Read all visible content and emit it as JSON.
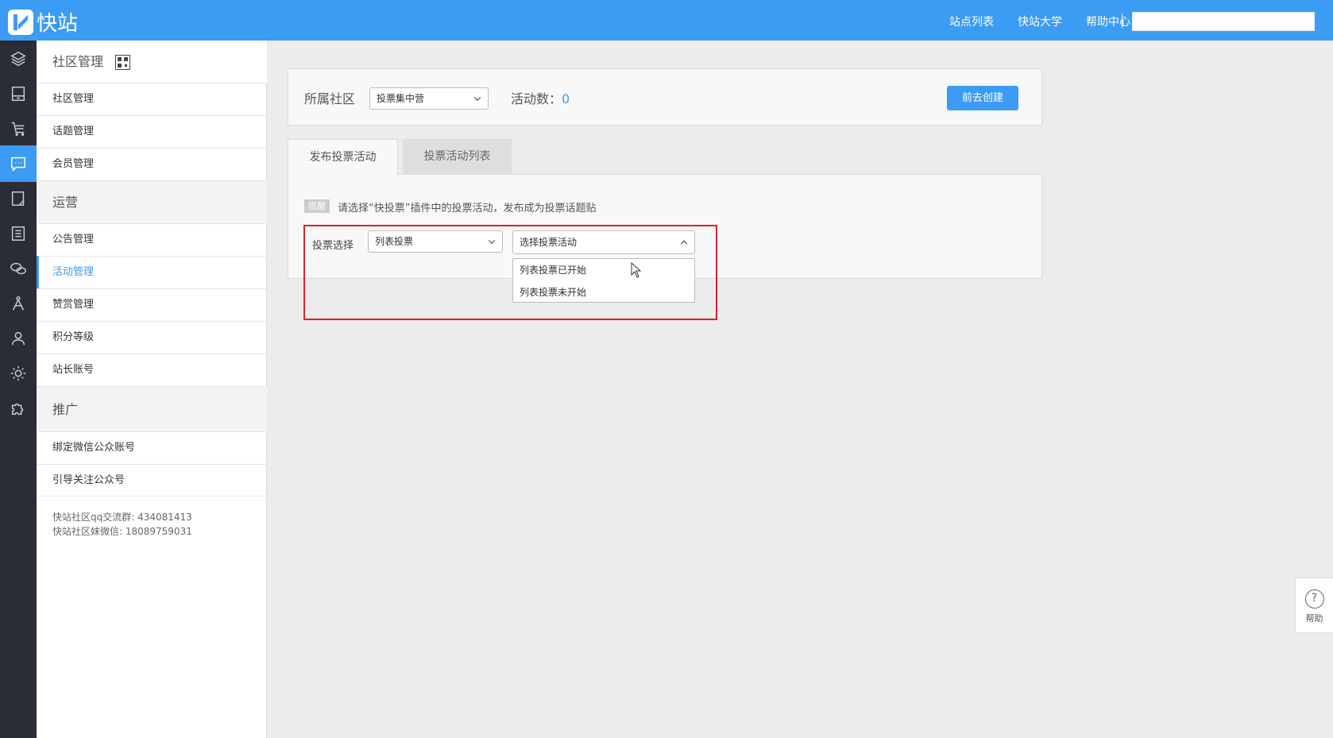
{
  "brand": {
    "name": "快站"
  },
  "topnav": {
    "links": [
      "站点列表",
      "快站大学",
      "帮助中心"
    ]
  },
  "rail": {
    "icons": [
      "layers-icon",
      "page-icon",
      "cart-icon",
      "chat-icon",
      "edit-doc-icon",
      "list-doc-icon",
      "wechat-icon",
      "compass-icon",
      "user-icon",
      "gear-icon",
      "puzzle-icon"
    ],
    "active_index": 3
  },
  "sidebar": {
    "section1": "社区管理",
    "items1": [
      "社区管理",
      "话题管理",
      "会员管理"
    ],
    "section2": "运营",
    "items2": [
      "公告管理",
      "活动管理",
      "赞赏管理",
      "积分等级",
      "站长账号"
    ],
    "section3": "推广",
    "items3": [
      "绑定微信公众账号",
      "引导关注公众号"
    ],
    "info_line1": "快站社区qq交流群: 434081413",
    "info_line2": "快站社区妹微信: 18089759031",
    "active_item": "活动管理"
  },
  "main": {
    "community_label": "所属社区",
    "community_value": "投票集中营",
    "count_label": "活动数：",
    "count_value": "0",
    "create_button": "前去创建",
    "tabs": [
      "发布投票活动",
      "投票活动列表"
    ],
    "tip_badge": "提醒",
    "tip_text": "请选择“快投票”插件中的投票活动，发布成为投票话题贴",
    "vote_label": "投票选择",
    "vote_type_value": "列表投票",
    "activity_placeholder": "选择投票活动",
    "activity_options": [
      "列表投票已开始",
      "列表投票未开始"
    ]
  },
  "help": {
    "label": "帮助"
  },
  "colors": {
    "accent": "#3c9cf4",
    "highlight_border": "#d9232b",
    "rail_bg": "#2b2d35"
  }
}
